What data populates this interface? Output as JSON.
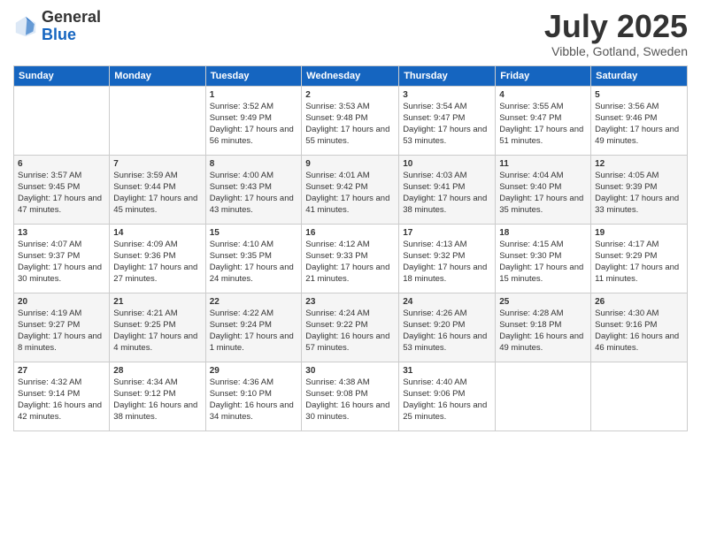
{
  "header": {
    "logo_general": "General",
    "logo_blue": "Blue",
    "month": "July 2025",
    "location": "Vibble, Gotland, Sweden"
  },
  "weekdays": [
    "Sunday",
    "Monday",
    "Tuesday",
    "Wednesday",
    "Thursday",
    "Friday",
    "Saturday"
  ],
  "rows": [
    [
      {
        "day": "",
        "text": ""
      },
      {
        "day": "",
        "text": ""
      },
      {
        "day": "1",
        "text": "Sunrise: 3:52 AM\nSunset: 9:49 PM\nDaylight: 17 hours and 56 minutes."
      },
      {
        "day": "2",
        "text": "Sunrise: 3:53 AM\nSunset: 9:48 PM\nDaylight: 17 hours and 55 minutes."
      },
      {
        "day": "3",
        "text": "Sunrise: 3:54 AM\nSunset: 9:47 PM\nDaylight: 17 hours and 53 minutes."
      },
      {
        "day": "4",
        "text": "Sunrise: 3:55 AM\nSunset: 9:47 PM\nDaylight: 17 hours and 51 minutes."
      },
      {
        "day": "5",
        "text": "Sunrise: 3:56 AM\nSunset: 9:46 PM\nDaylight: 17 hours and 49 minutes."
      }
    ],
    [
      {
        "day": "6",
        "text": "Sunrise: 3:57 AM\nSunset: 9:45 PM\nDaylight: 17 hours and 47 minutes."
      },
      {
        "day": "7",
        "text": "Sunrise: 3:59 AM\nSunset: 9:44 PM\nDaylight: 17 hours and 45 minutes."
      },
      {
        "day": "8",
        "text": "Sunrise: 4:00 AM\nSunset: 9:43 PM\nDaylight: 17 hours and 43 minutes."
      },
      {
        "day": "9",
        "text": "Sunrise: 4:01 AM\nSunset: 9:42 PM\nDaylight: 17 hours and 41 minutes."
      },
      {
        "day": "10",
        "text": "Sunrise: 4:03 AM\nSunset: 9:41 PM\nDaylight: 17 hours and 38 minutes."
      },
      {
        "day": "11",
        "text": "Sunrise: 4:04 AM\nSunset: 9:40 PM\nDaylight: 17 hours and 35 minutes."
      },
      {
        "day": "12",
        "text": "Sunrise: 4:05 AM\nSunset: 9:39 PM\nDaylight: 17 hours and 33 minutes."
      }
    ],
    [
      {
        "day": "13",
        "text": "Sunrise: 4:07 AM\nSunset: 9:37 PM\nDaylight: 17 hours and 30 minutes."
      },
      {
        "day": "14",
        "text": "Sunrise: 4:09 AM\nSunset: 9:36 PM\nDaylight: 17 hours and 27 minutes."
      },
      {
        "day": "15",
        "text": "Sunrise: 4:10 AM\nSunset: 9:35 PM\nDaylight: 17 hours and 24 minutes."
      },
      {
        "day": "16",
        "text": "Sunrise: 4:12 AM\nSunset: 9:33 PM\nDaylight: 17 hours and 21 minutes."
      },
      {
        "day": "17",
        "text": "Sunrise: 4:13 AM\nSunset: 9:32 PM\nDaylight: 17 hours and 18 minutes."
      },
      {
        "day": "18",
        "text": "Sunrise: 4:15 AM\nSunset: 9:30 PM\nDaylight: 17 hours and 15 minutes."
      },
      {
        "day": "19",
        "text": "Sunrise: 4:17 AM\nSunset: 9:29 PM\nDaylight: 17 hours and 11 minutes."
      }
    ],
    [
      {
        "day": "20",
        "text": "Sunrise: 4:19 AM\nSunset: 9:27 PM\nDaylight: 17 hours and 8 minutes."
      },
      {
        "day": "21",
        "text": "Sunrise: 4:21 AM\nSunset: 9:25 PM\nDaylight: 17 hours and 4 minutes."
      },
      {
        "day": "22",
        "text": "Sunrise: 4:22 AM\nSunset: 9:24 PM\nDaylight: 17 hours and 1 minute."
      },
      {
        "day": "23",
        "text": "Sunrise: 4:24 AM\nSunset: 9:22 PM\nDaylight: 16 hours and 57 minutes."
      },
      {
        "day": "24",
        "text": "Sunrise: 4:26 AM\nSunset: 9:20 PM\nDaylight: 16 hours and 53 minutes."
      },
      {
        "day": "25",
        "text": "Sunrise: 4:28 AM\nSunset: 9:18 PM\nDaylight: 16 hours and 49 minutes."
      },
      {
        "day": "26",
        "text": "Sunrise: 4:30 AM\nSunset: 9:16 PM\nDaylight: 16 hours and 46 minutes."
      }
    ],
    [
      {
        "day": "27",
        "text": "Sunrise: 4:32 AM\nSunset: 9:14 PM\nDaylight: 16 hours and 42 minutes."
      },
      {
        "day": "28",
        "text": "Sunrise: 4:34 AM\nSunset: 9:12 PM\nDaylight: 16 hours and 38 minutes."
      },
      {
        "day": "29",
        "text": "Sunrise: 4:36 AM\nSunset: 9:10 PM\nDaylight: 16 hours and 34 minutes."
      },
      {
        "day": "30",
        "text": "Sunrise: 4:38 AM\nSunset: 9:08 PM\nDaylight: 16 hours and 30 minutes."
      },
      {
        "day": "31",
        "text": "Sunrise: 4:40 AM\nSunset: 9:06 PM\nDaylight: 16 hours and 25 minutes."
      },
      {
        "day": "",
        "text": ""
      },
      {
        "day": "",
        "text": ""
      }
    ]
  ]
}
